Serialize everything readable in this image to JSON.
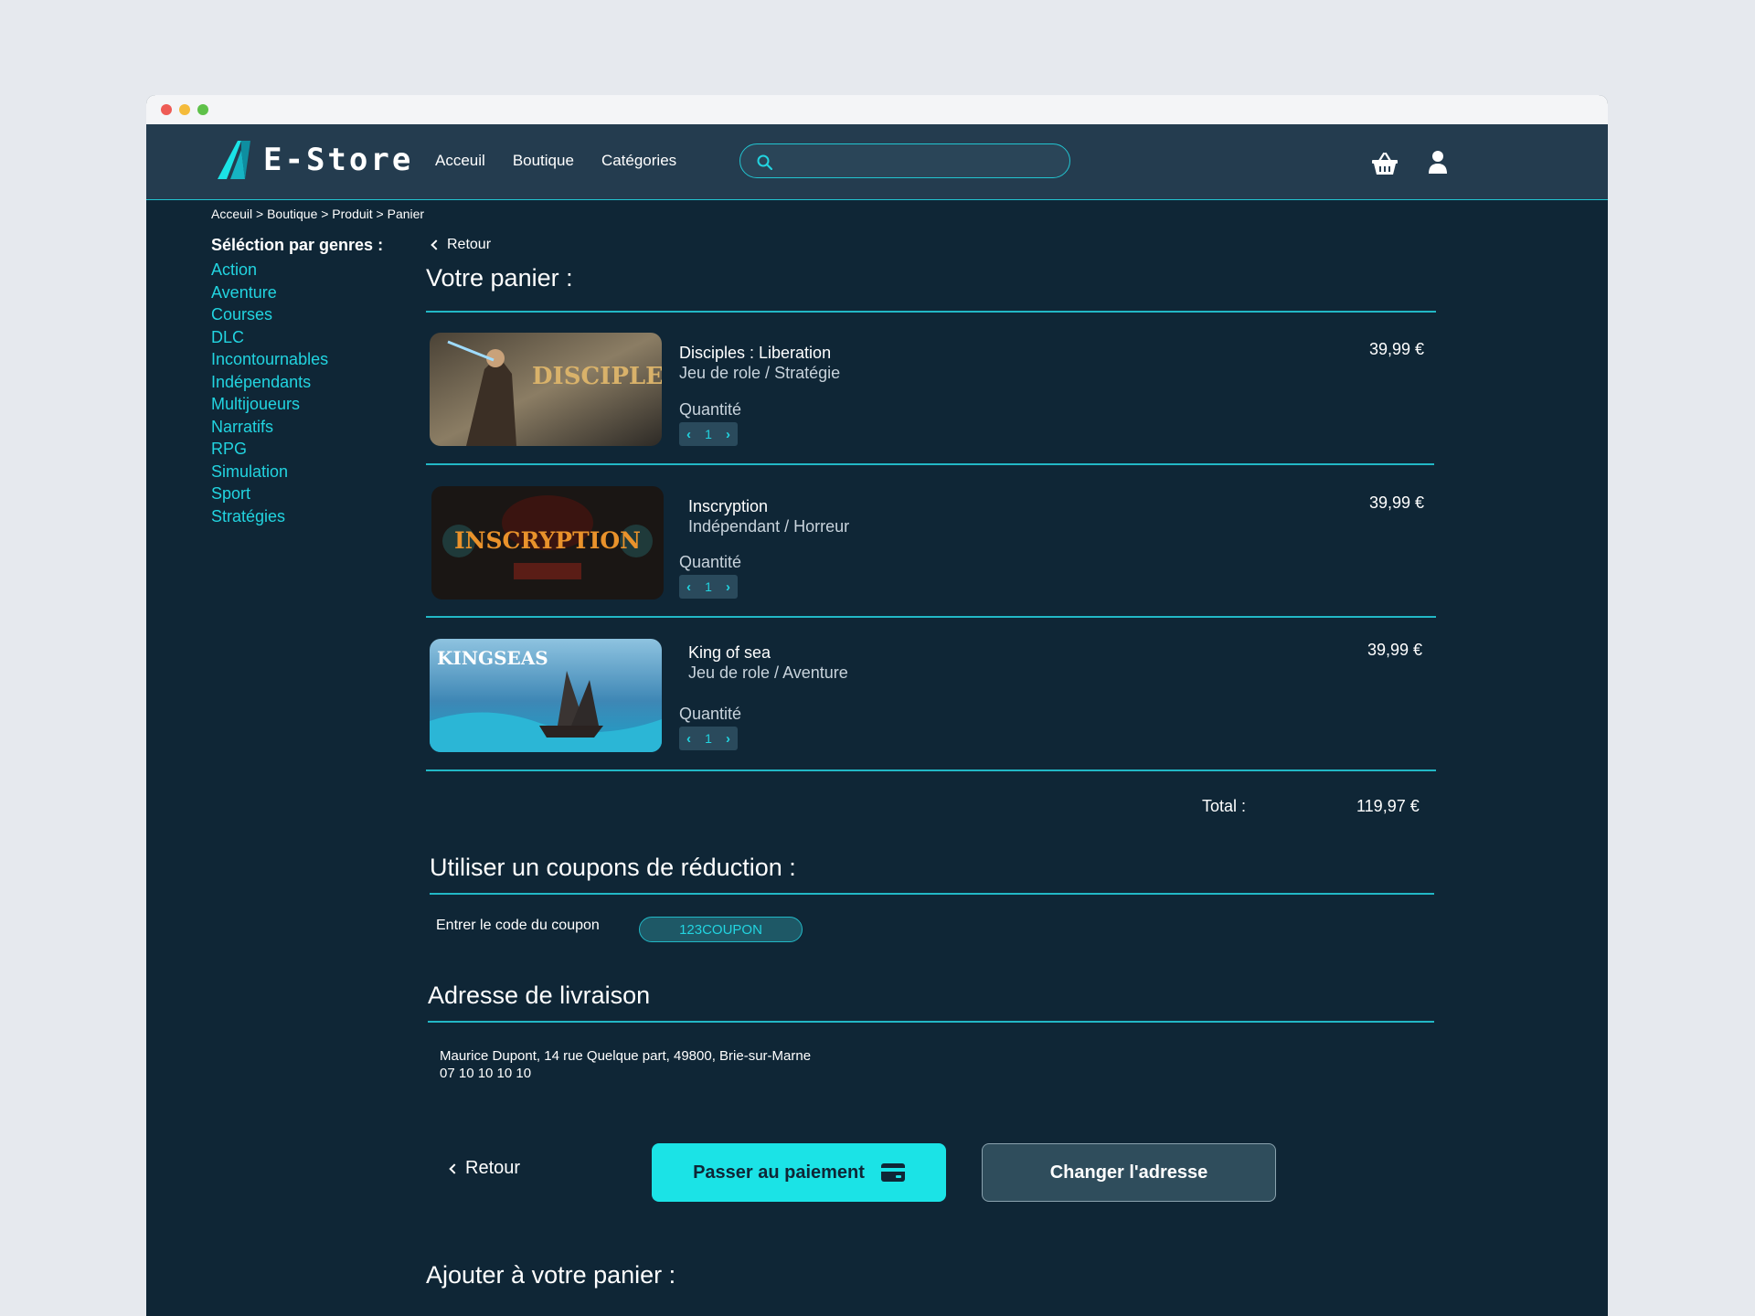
{
  "brand": {
    "name": "E-Store",
    "accent": "#22d4e0"
  },
  "nav": {
    "links": [
      "Acceuil",
      "Boutique",
      "Catégories"
    ]
  },
  "search": {
    "placeholder": ""
  },
  "breadcrumb": "Acceuil > Boutique > Produit > Panier",
  "sidebar": {
    "title": "Séléction par genres :",
    "genres": [
      "Action",
      "Aventure",
      "Courses",
      "DLC",
      "Incontournables",
      "Indépendants",
      "Multijoueurs",
      "Narratifs",
      "RPG",
      "Simulation",
      "Sport",
      "Stratégies"
    ]
  },
  "back_label": "Retour",
  "cart": {
    "title": "Votre panier :",
    "qty_label": "Quantité",
    "items": [
      {
        "name": "Disciples : Liberation",
        "genre": "Jeu de role / Stratégie",
        "quantity": "1",
        "price": "39,99 €",
        "image_text": "DISCIPLES"
      },
      {
        "name": "Inscryption",
        "genre": "Indépendant / Horreur",
        "quantity": "1",
        "price": "39,99 €",
        "image_text": "INSCRYPTION"
      },
      {
        "name": "King of sea",
        "genre": "Jeu de role / Aventure",
        "quantity": "1",
        "price": "39,99 €",
        "image_text": "KINGSEAS"
      }
    ],
    "total_label": "Total :",
    "total_value": "119,97 €"
  },
  "coupon": {
    "title": "Utiliser un coupons de réduction :",
    "label": "Entrer le code du coupon",
    "value": "123COUPON"
  },
  "delivery": {
    "title": "Adresse de livraison",
    "address_line": "Maurice Dupont, 14 rue Quelque part, 49800, Brie-sur-Marne",
    "phone": "07 10 10 10 10"
  },
  "actions": {
    "back": "Retour",
    "pay": "Passer au paiement",
    "change_address": "Changer l'adresse"
  },
  "add_section_title": "Ajouter à votre panier :"
}
